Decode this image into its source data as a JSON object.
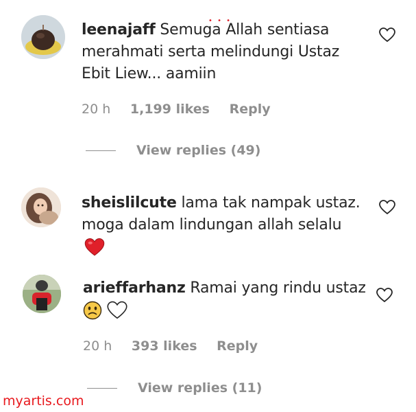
{
  "comments": [
    {
      "username": "leenajaff",
      "text_line1": "Semuga Allah sentiasa",
      "text_line2": "merahmati serta melindungi Ustaz",
      "text_line3": "Ebit Liew... aamiin",
      "time": "20 h",
      "likes": "1,199 likes",
      "reply": "Reply",
      "view_replies": "View replies (49)",
      "avatar_icon": "cake-avatar"
    },
    {
      "username": "sheislilcute",
      "text_line1": "lama tak nampak ustaz.",
      "text_line2": "moga dalam lindungan allah selalu",
      "emoji": "red-heart",
      "avatar_icon": "girl-avatar"
    },
    {
      "username": "arieffarhanz",
      "text_line1": "Ramai yang rindu ustaz",
      "emoji": "frowning-face, white-heart",
      "time": "20 h",
      "likes": "393 likes",
      "reply": "Reply",
      "view_replies": "View replies (11)",
      "avatar_icon": "motorcycle-avatar"
    }
  ],
  "watermark": "myartis.com",
  "colors": {
    "text": "#262626",
    "meta": "#8e8e8e",
    "watermark": "#e8181d",
    "heart_red": "#e0202a"
  }
}
